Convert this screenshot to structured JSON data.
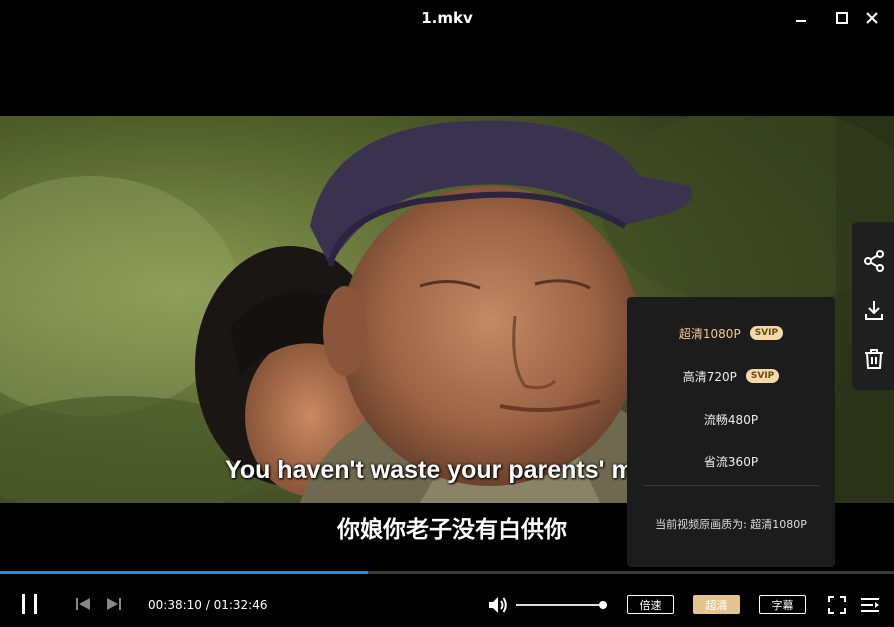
{
  "window": {
    "title": "1.mkv"
  },
  "subtitles": {
    "english": "You haven't waste your parents' money",
    "chinese": "你娘你老子没有白供你"
  },
  "side_tools": [
    {
      "name": "share-icon"
    },
    {
      "name": "download-icon"
    },
    {
      "name": "trash-icon"
    }
  ],
  "quality_menu": {
    "options": [
      {
        "label": "超清1080P",
        "badge": "SVIP",
        "selected": true
      },
      {
        "label": "高清720P",
        "badge": "SVIP",
        "selected": false
      },
      {
        "label": "流畅480P",
        "badge": "",
        "selected": false
      },
      {
        "label": "省流360P",
        "badge": "",
        "selected": false
      }
    ],
    "current_text": "当前视频原画质为: 超清1080P"
  },
  "player": {
    "progress_percent": 41.2,
    "time_display": "00:38:10 / 01:32:46",
    "volume_percent": 100,
    "speed_label": "倍速",
    "quality_label": "超清",
    "subtitle_label": "字幕"
  },
  "colors": {
    "accent_progress": "#1f8de5",
    "quality_gold": "#e4c48f",
    "svip_badge": "#f5d9a6"
  }
}
